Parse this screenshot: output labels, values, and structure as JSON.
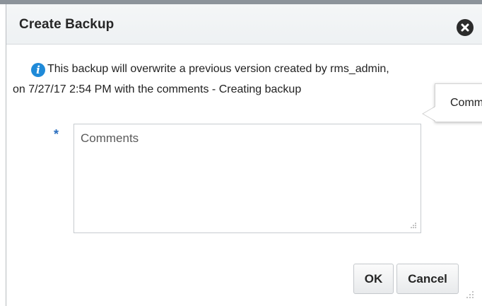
{
  "dialog": {
    "title": "Create Backup",
    "close_icon": "close-circle-icon"
  },
  "info": {
    "icon": "info-icon",
    "icon_glyph": "i",
    "line1": "This backup will overwrite a previous version created by rms_admin,",
    "line2": "on 7/27/17 2:54 PM with the comments - Creating backup"
  },
  "tooltip": {
    "text": "Comments"
  },
  "form": {
    "required_marker": "*",
    "comments_placeholder": "Comments",
    "comments_value": ""
  },
  "buttons": {
    "ok_label": "OK",
    "cancel_label": "Cancel"
  },
  "colors": {
    "info_icon": "#1f8ad8",
    "required_marker": "#2b6fbf",
    "close_icon": "#2b2b2b"
  }
}
